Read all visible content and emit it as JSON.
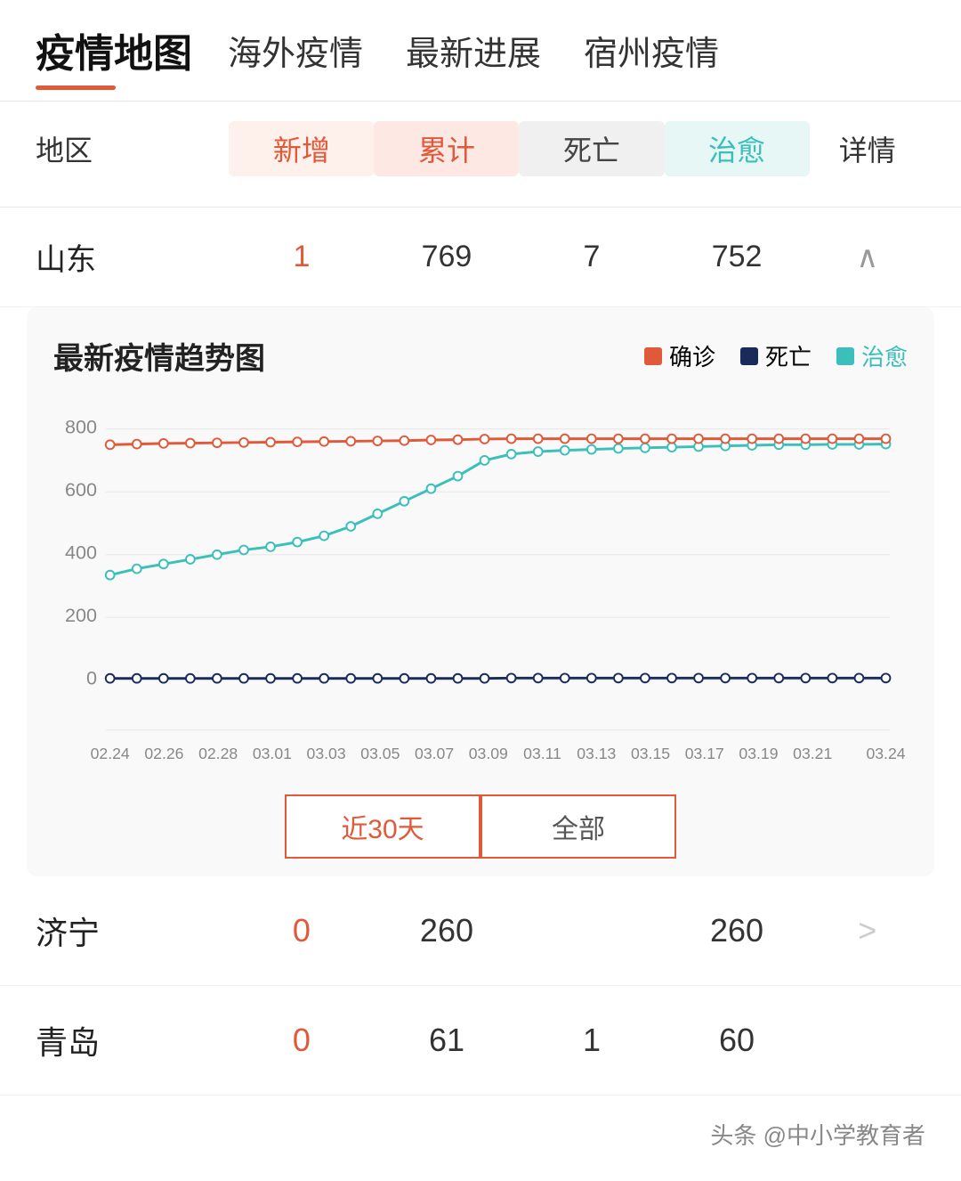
{
  "header": {
    "title": "疫情地图",
    "nav_items": [
      "海外疫情",
      "最新进展",
      "宿州疫情"
    ]
  },
  "table": {
    "headers": {
      "region": "地区",
      "new": "新增",
      "total": "累计",
      "death": "死亡",
      "recovered": "治愈",
      "detail": "详情"
    },
    "shandong_row": {
      "region": "山东",
      "new": "1",
      "total": "769",
      "death": "7",
      "recovered": "752",
      "detail": "∧"
    }
  },
  "chart": {
    "title": "最新疫情趋势图",
    "legend": {
      "confirmed": "确诊",
      "death": "死亡",
      "recovered": "治愈"
    },
    "legend_colors": {
      "confirmed": "#e05a3a",
      "death": "#1a2a5a",
      "recovered": "#3bbfba"
    },
    "y_labels": [
      "800",
      "600",
      "400",
      "200",
      "0"
    ],
    "x_labels": [
      "02.24",
      "02.26",
      "02.28",
      "03.01",
      "03.03",
      "03.05",
      "03.07",
      "03.09",
      "03.11",
      "03.13",
      "03.15",
      "03.17",
      "03.19",
      "03.21",
      "03.24"
    ],
    "time_filter": {
      "active": "近30天",
      "inactive": "全部"
    },
    "confirmed_data": [
      750,
      752,
      754,
      755,
      756,
      757,
      758,
      759,
      760,
      761,
      762,
      763,
      765,
      766,
      768,
      769,
      769,
      769,
      769,
      769,
      769,
      769,
      769,
      769,
      769,
      769,
      769,
      769,
      769,
      769
    ],
    "death_data": [
      6,
      6,
      6,
      6,
      6,
      6,
      6,
      6,
      6,
      6,
      6,
      6,
      6,
      6,
      6,
      7,
      7,
      7,
      7,
      7,
      7,
      7,
      7,
      7,
      7,
      7,
      7,
      7,
      7,
      7
    ],
    "recovered_data": [
      335,
      355,
      370,
      385,
      400,
      415,
      425,
      440,
      460,
      490,
      530,
      570,
      610,
      650,
      700,
      720,
      728,
      732,
      735,
      738,
      740,
      742,
      744,
      746,
      748,
      750,
      750,
      751,
      751,
      752
    ]
  },
  "bottom_rows": [
    {
      "region": "济宁",
      "new": "0",
      "total": "260",
      "death": "",
      "recovered": "260",
      "detail": ">"
    },
    {
      "region": "青岛",
      "new": "0",
      "total": "61",
      "death": "1",
      "recovered": "60",
      "detail": ""
    }
  ],
  "watermark": "头条 @中小学教育者"
}
